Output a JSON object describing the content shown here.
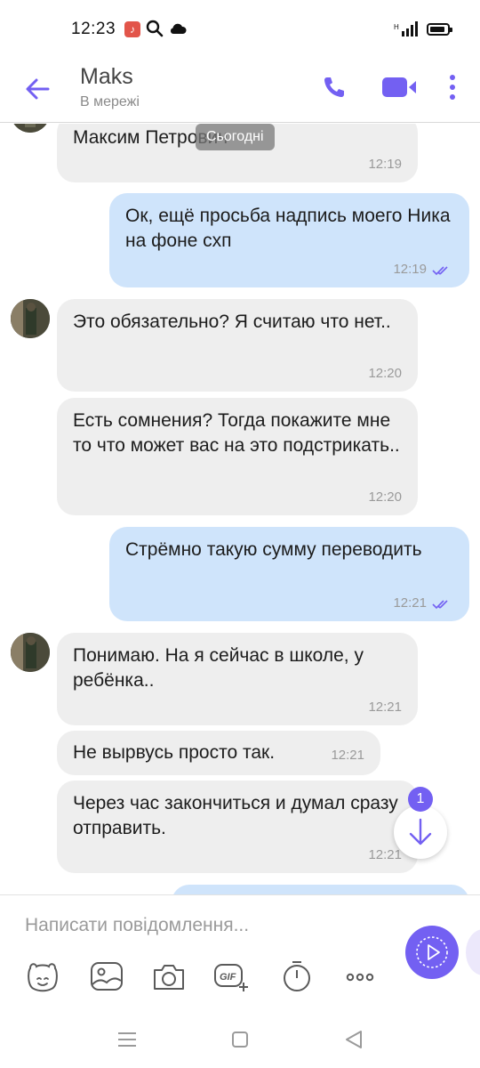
{
  "status_bar": {
    "time": "12:23",
    "icons": [
      "music-app-icon",
      "search-icon",
      "cloud-icon",
      "network-signal-icon",
      "battery-icon"
    ]
  },
  "header": {
    "contact_name": "Maks",
    "contact_status": "В мережі",
    "icons": [
      "back-arrow-icon",
      "phone-icon",
      "video-camera-icon",
      "more-vertical-icon"
    ],
    "accent_color": "#7360f2"
  },
  "chat": {
    "date_separator": "Сьогодні",
    "messages": [
      {
        "direction": "in",
        "text": "Максим Петрович",
        "time": "12:19"
      },
      {
        "direction": "out",
        "text": "Ок, ещё просьба надпись моего Ника на фоне схп",
        "time": "12:19",
        "read": true
      },
      {
        "direction": "in",
        "text": "Это обязательно? Я считаю что нет..",
        "time": "12:20",
        "avatar": true
      },
      {
        "direction": "in",
        "text": "Есть сомнения? Тогда покажите мне то что может вас на это подстрикать..",
        "time": "12:20"
      },
      {
        "direction": "out",
        "text": "Стрёмно такую сумму переводить",
        "time": "12:21",
        "read": true
      },
      {
        "direction": "in",
        "text": "Понимаю. На я сейчас в школе, у ребёнка..",
        "time": "12:21",
        "avatar": true
      },
      {
        "direction": "in",
        "text": "Не вырвусь просто так.",
        "time": "12:21"
      },
      {
        "direction": "in",
        "text": "Через час закончиться и думал сразу отправить.",
        "time": "12:21"
      }
    ],
    "unread_count": "1",
    "incoming_bubble_color": "#eeeeee",
    "outgoing_bubble_color": "#cfe4fb"
  },
  "composer": {
    "placeholder": "Написати повідомлення...",
    "tools": [
      "sticker-icon",
      "gallery-icon",
      "camera-icon",
      "gif-icon",
      "timer-icon",
      "more-horizontal-icon"
    ],
    "gif_label": "GIF"
  },
  "navbar": {
    "icons": [
      "recent-apps-icon",
      "home-icon",
      "back-triangle-icon"
    ]
  }
}
